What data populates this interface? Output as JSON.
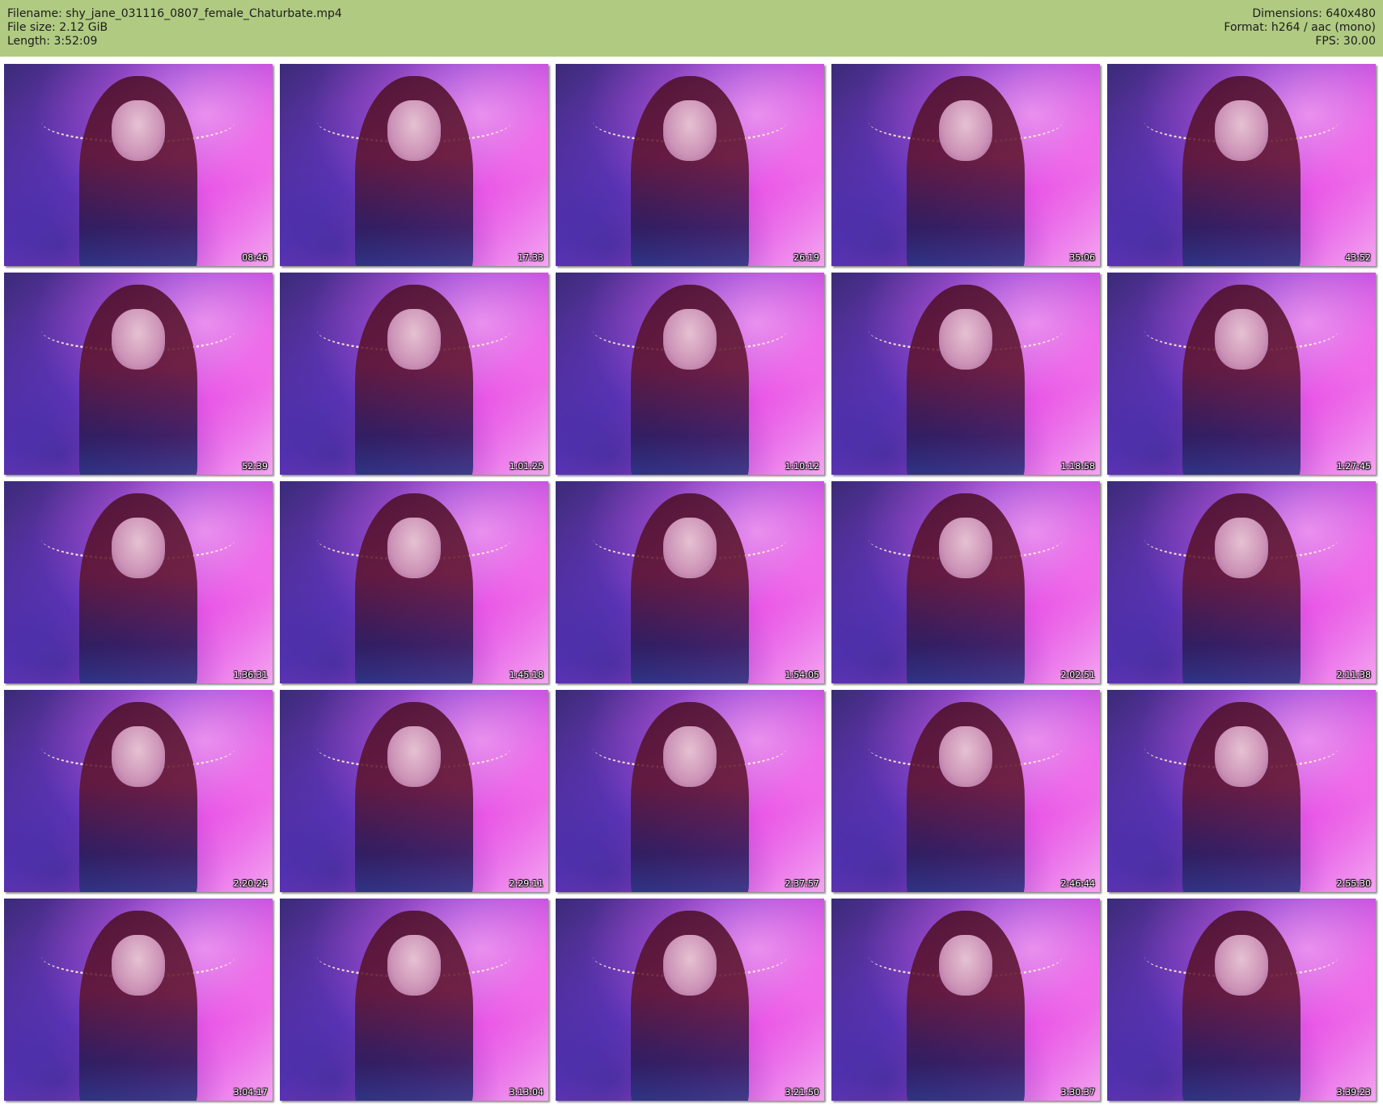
{
  "header": {
    "background_color": "#b0ca82",
    "filename": "Filename: shy_jane_031116_0807_female_Chaturbate.mp4",
    "file_size": "File size: 2.12 GiB",
    "length": "Length: 3:52:09",
    "dimensions": "Dimensions: 640x480",
    "format": "Format: h264 / aac (mono)",
    "fps": "FPS: 30.00"
  },
  "thumbnails": [
    {
      "timestamp": "08:46"
    },
    {
      "timestamp": "17:33"
    },
    {
      "timestamp": "26:19"
    },
    {
      "timestamp": "35:06"
    },
    {
      "timestamp": "43:52"
    },
    {
      "timestamp": "52:39"
    },
    {
      "timestamp": "1:01:25"
    },
    {
      "timestamp": "1:10:12"
    },
    {
      "timestamp": "1:18:58"
    },
    {
      "timestamp": "1:27:45"
    },
    {
      "timestamp": "1:36:31"
    },
    {
      "timestamp": "1:45:18"
    },
    {
      "timestamp": "1:54:05"
    },
    {
      "timestamp": "2:02:51"
    },
    {
      "timestamp": "2:11:38"
    },
    {
      "timestamp": "2:20:24"
    },
    {
      "timestamp": "2:29:11"
    },
    {
      "timestamp": "2:37:57"
    },
    {
      "timestamp": "2:46:44"
    },
    {
      "timestamp": "2:55:30"
    },
    {
      "timestamp": "3:04:17"
    },
    {
      "timestamp": "3:13:04"
    },
    {
      "timestamp": "3:21:50"
    },
    {
      "timestamp": "3:30:37"
    },
    {
      "timestamp": "3:39:23"
    }
  ]
}
